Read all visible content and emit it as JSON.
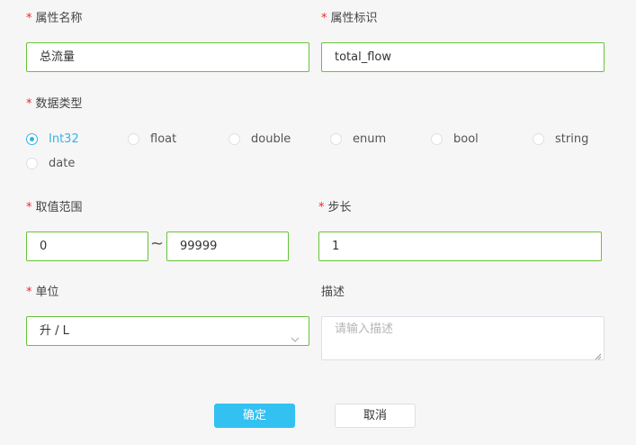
{
  "fields": {
    "attr_name": {
      "label": "属性名称",
      "value": "总流量"
    },
    "attr_id": {
      "label": "属性标识",
      "value": "total_flow"
    },
    "data_type": {
      "label": "数据类型",
      "options": [
        "Int32",
        "float",
        "double",
        "enum",
        "bool",
        "string",
        "date"
      ],
      "selected": "Int32"
    },
    "range": {
      "label": "取值范围",
      "min": "0",
      "separator": "~",
      "max": "99999"
    },
    "step": {
      "label": "步长",
      "value": "1"
    },
    "unit": {
      "label": "单位",
      "value": "升 / L"
    },
    "description": {
      "label": "描述",
      "placeholder": "请输入描述"
    }
  },
  "required_mark": "*",
  "buttons": {
    "confirm": "确定",
    "cancel": "取消"
  },
  "colors": {
    "accent": "#33b5e5",
    "primary_button": "#33c1f2",
    "valid_border": "#67c23a",
    "required": "#f5222d"
  },
  "icons": {
    "select_arrow": "chevron-down-icon"
  }
}
